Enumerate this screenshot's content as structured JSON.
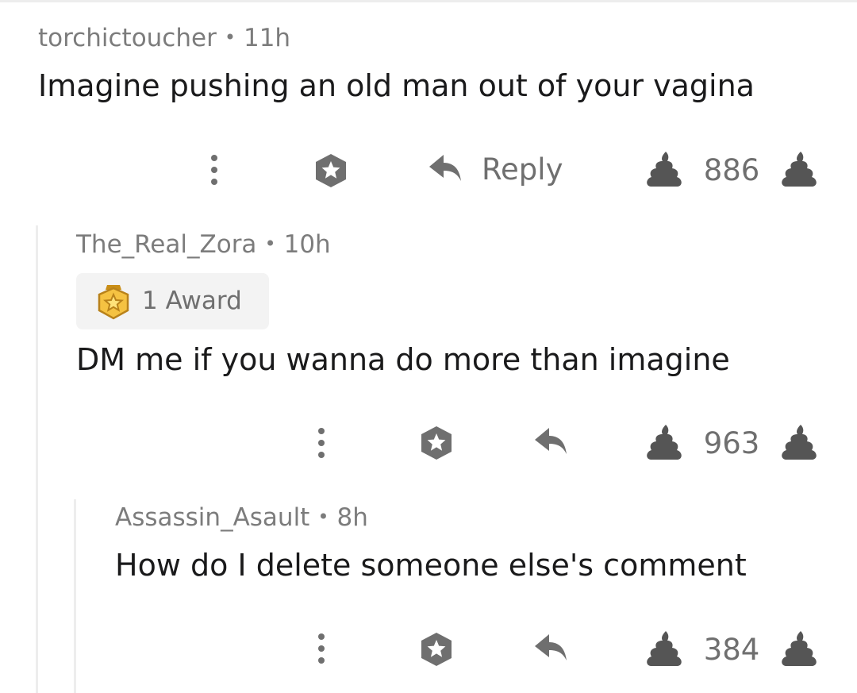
{
  "comments": [
    {
      "author": "torchictoucher",
      "separator": "•",
      "age": "11h",
      "body": "Imagine pushing an old man out of your vagina",
      "reply_label": "Reply",
      "score": "886"
    },
    {
      "author": "The_Real_Zora",
      "separator": "•",
      "age": "10h",
      "award_label": "1 Award",
      "body": "DM me if you wanna do more than imagine",
      "score": "963"
    },
    {
      "author": "Assassin_Asault",
      "separator": "•",
      "age": "8h",
      "body": "How do I delete someone else's comment",
      "score": "384"
    }
  ],
  "icons": {
    "more": "more-options-icon",
    "award": "give-award-icon",
    "reply": "reply-arrow-icon",
    "upvote": "poop-upvote-icon",
    "downvote": "poop-downvote-icon",
    "award_badge": "award-badge-icon"
  },
  "colors": {
    "icon_gray": "#6f6f6f",
    "vote_dark": "#555555",
    "meta_gray": "#7c7c7c",
    "award_gold": "#f5c242"
  }
}
